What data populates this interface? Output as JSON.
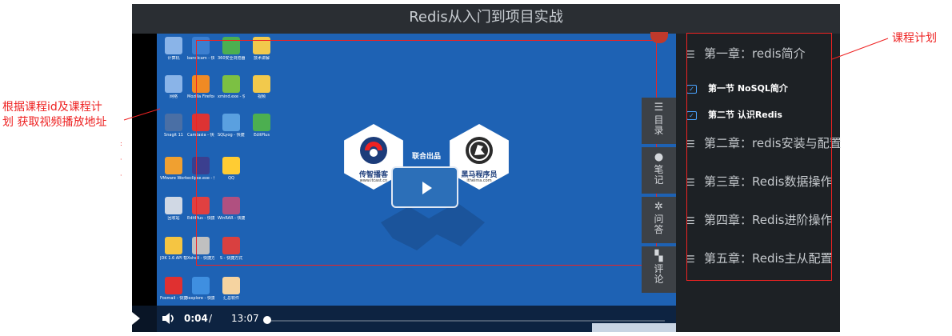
{
  "player": {
    "title": "Redis从入门到项目实战"
  },
  "desktop": {
    "icons": [
      {
        "name": "computer",
        "label": "计算机",
        "color": "#8ab4e8"
      },
      {
        "name": "bandicam",
        "label": "bandicam - 快捷方式",
        "color": "#3c7fd0"
      },
      {
        "name": "browser360",
        "label": "360安全浏览器",
        "color": "#4caf50"
      },
      {
        "name": "folder",
        "label": "技术讲解",
        "color": "#f2c94c"
      },
      {
        "name": "network",
        "label": "网络",
        "color": "#8ab4e8"
      },
      {
        "name": "firefox",
        "label": "Mozilla Firefox",
        "color": "#f08a24"
      },
      {
        "name": "xmind",
        "label": "xmind.exe - 快捷方式",
        "color": "#7cc043"
      },
      {
        "name": "folder2",
        "label": "视频",
        "color": "#f2c94c"
      },
      {
        "name": "snagit",
        "label": "Snagit 11",
        "color": "#4a6fa5"
      },
      {
        "name": "camtasia",
        "label": "Camtasia - 快捷方式",
        "color": "#d33"
      },
      {
        "name": "dolphin",
        "label": "SQLyog - 快捷方式",
        "color": "#5aa0e0"
      },
      {
        "name": "evernote",
        "label": "EditPlus",
        "color": "#4caf50"
      },
      {
        "name": "vmware",
        "label": "VMware Workstation",
        "color": "#f0a030"
      },
      {
        "name": "eclipse",
        "label": "eclipse.exe - 快捷方式",
        "color": "#3b3f8f"
      },
      {
        "name": "qq",
        "label": "QQ",
        "color": "#ffcc33"
      },
      {
        "name": "recycle",
        "label": "回收站",
        "color": "#d0d8e4"
      },
      {
        "name": "editplus",
        "label": "EditPlus - 快捷方式",
        "color": "#e04040"
      },
      {
        "name": "winrar",
        "label": "WinRAR - 快捷方式",
        "color": "#b05080"
      },
      {
        "name": "help",
        "label": "JDK 1.6 API 帮助文档",
        "color": "#f5c542"
      },
      {
        "name": "xshell",
        "label": "Xshell - 快捷方式",
        "color": "#c0c0c0"
      },
      {
        "name": "sqlyog",
        "label": "S - 快捷方式",
        "color": "#d94040"
      },
      {
        "name": "foxmail",
        "label": "Foxmail - 快捷方式",
        "color": "#e03030"
      },
      {
        "name": "ie",
        "label": "iexplore - 快捷方式",
        "color": "#3f8fe0"
      },
      {
        "name": "avatar",
        "label": "汇总软件",
        "color": "#f5d3a0"
      }
    ]
  },
  "logos": {
    "left_brand": "传智播客",
    "left_url": "www.itcast.cn",
    "joint": "联合出品",
    "right_brand": "黑马程序员",
    "right_url": "itheima.com"
  },
  "controls": {
    "current_time": "0:04",
    "separator": "/",
    "duration": "13:07",
    "progress_fraction": 0.005
  },
  "side_tabs": [
    {
      "icon": "catalog-icon",
      "glyph": "☰",
      "label": "目录"
    },
    {
      "icon": "user-icon",
      "glyph": "●",
      "label": "笔记"
    },
    {
      "icon": "gear-icon",
      "glyph": "✲",
      "label": "问答"
    },
    {
      "icon": "comment-icon",
      "glyph": "▚",
      "label": "评论"
    }
  ],
  "chapters": [
    {
      "title": "第一章：redis简介"
    },
    {
      "title": "第二章：redis安装与配置"
    },
    {
      "title": "第三章：Redis数据操作"
    },
    {
      "title": "第四章：Redis进阶操作"
    },
    {
      "title": "第五章：Redis主从配置"
    }
  ],
  "sections": [
    {
      "title": "第一节 NoSQL简介"
    },
    {
      "title": "第二节 认识Redis"
    }
  ],
  "annotations": {
    "left_line1": "根据课程id及课程计",
    "left_line2": "划 获取视频播放地址",
    "right": "课程计划"
  },
  "colors": {
    "annotation": "#ee2222",
    "desktop_bg": "#1e62b4",
    "panel_bg": "#1d2125",
    "accent": "#4aa3ff"
  }
}
